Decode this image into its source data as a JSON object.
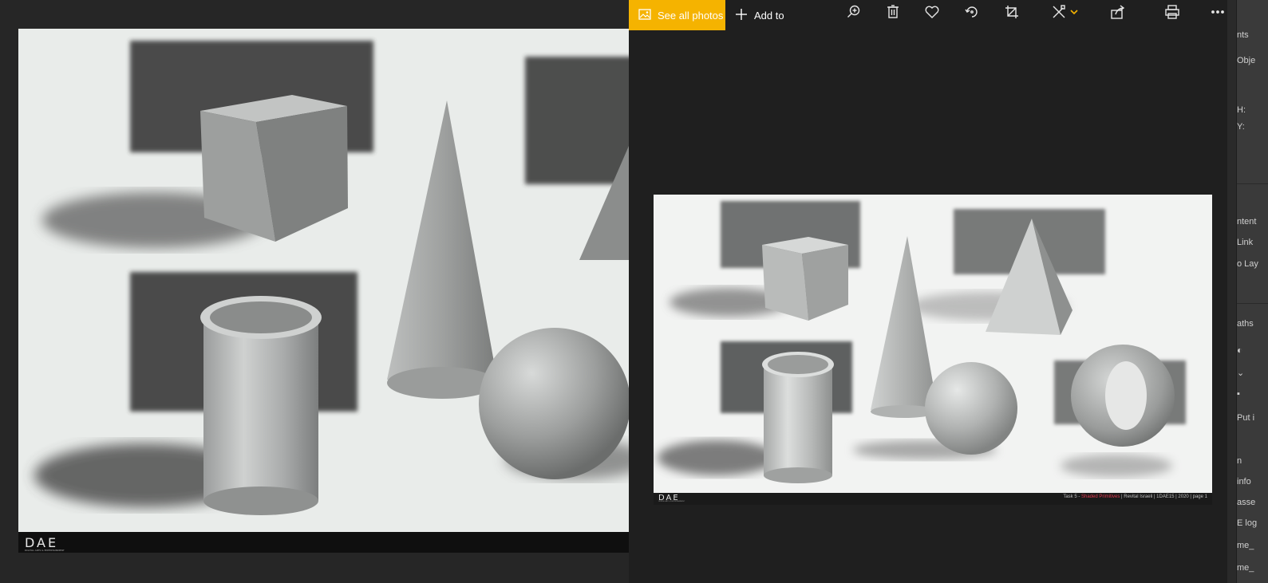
{
  "photos_app": {
    "toolbar": {
      "see_all_label": "See all photos",
      "add_to_label": "Add to",
      "icons": [
        "zoom-in-icon",
        "delete-icon",
        "favorite-icon",
        "rotate-icon",
        "crop-icon",
        "edit-icon",
        "share-icon",
        "print-icon",
        "more-icon"
      ]
    },
    "photo": {
      "footer": {
        "task": "Task 5 - ",
        "title": "Shaded Primitives",
        "rest": " | Revital Israeli | 1DAE15 | 2020 | page 1"
      },
      "logo_text": "DAE",
      "logo_sub": "DIGITAL ARTS & ENTERTAINMENT"
    },
    "accent_color": "#f5b300"
  },
  "background_editor": {
    "logo_text": "DAE",
    "logo_sub": "DIGITAL ARTS & ENTERTAINMENT",
    "right_panel": {
      "items": [
        "nts",
        "Obje",
        "H:",
        "Y:",
        "ntent",
        "Link",
        "o Lay",
        "aths",
        "Put i",
        "n",
        "info",
        "asse",
        "E log",
        "me_",
        "me_"
      ]
    }
  }
}
